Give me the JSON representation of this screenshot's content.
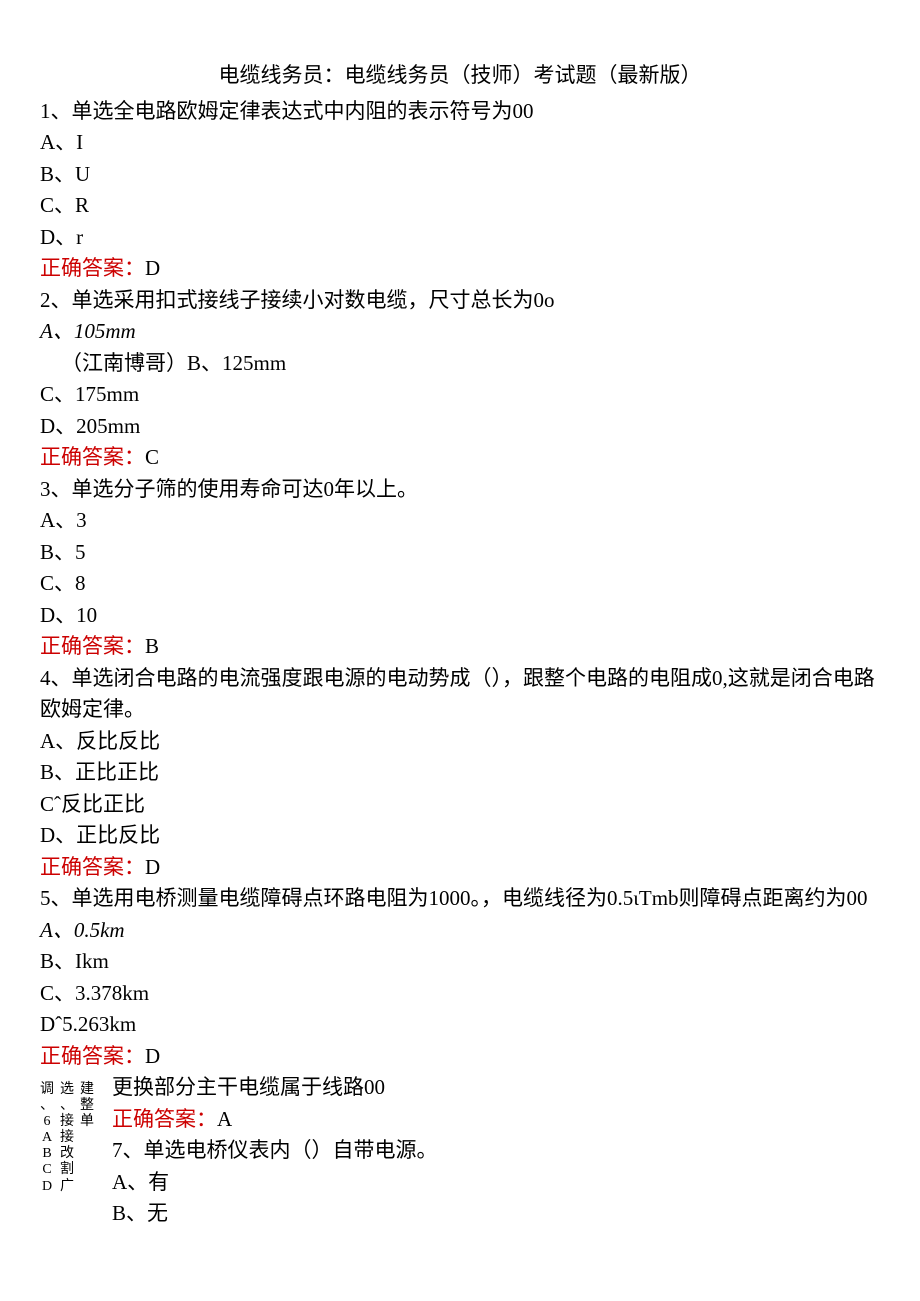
{
  "title": "电缆线务员：电缆线务员（技师）考试题（最新版）",
  "answer_label": "正确答案：",
  "q1": {
    "stem": "1、单选全电路欧姆定律表达式中内阻的表示符号为00",
    "A": "A、I",
    "B": "B、U",
    "C": "C、R",
    "D": "D、r",
    "ans": "D"
  },
  "q2": {
    "stem": "2、单选采用扣式接线子接续小对数电缆，尺寸总长为0o",
    "A": "A、105mm",
    "note": "（江南博哥）B、125mm",
    "C": "C、175mm",
    "D": "D、205mm",
    "ans": "C"
  },
  "q3": {
    "stem": "3、单选分子筛的使用寿命可达0年以上。",
    "A": "A、3",
    "B": "B、5",
    "C": "C、8",
    "D": "D、10",
    "ans": "B"
  },
  "q4": {
    "stem": "4、单选闭合电路的电流强度跟电源的电动势成（），跟整个电路的电阻成0,这就是闭合电路欧姆定律。",
    "A": "A、反比反比",
    "B": "B、正比正比",
    "C": "Cˆ反比正比",
    "D": "D、正比反比",
    "ans": "D"
  },
  "q5": {
    "stem": "5、单选用电桥测量电缆障碍点环路电阻为1000。，电缆线径为0.5ιTmb则障碍点距离约为00",
    "A": "A、0.5km",
    "B": "B、Ikm",
    "C": "C、3.378km",
    "D": "Dˆ5.263km",
    "ans": "D"
  },
  "bottom": {
    "vcol1": [
      "调",
      "、",
      "6",
      "A",
      "B",
      "C",
      "D"
    ],
    "vcol2": [
      "选",
      "、",
      "接",
      "接",
      "改",
      "割",
      "广"
    ],
    "vcol3": [
      "",
      "",
      "建",
      "",
      "整",
      "",
      "单"
    ],
    "row1": "更换部分主干电缆属于线路00",
    "row2_label": "正确答案：",
    "row2_ans": "A",
    "row3": "7、单选电桥仪表内（）自带电源。",
    "row4": "A、有",
    "row5": "B、无"
  }
}
